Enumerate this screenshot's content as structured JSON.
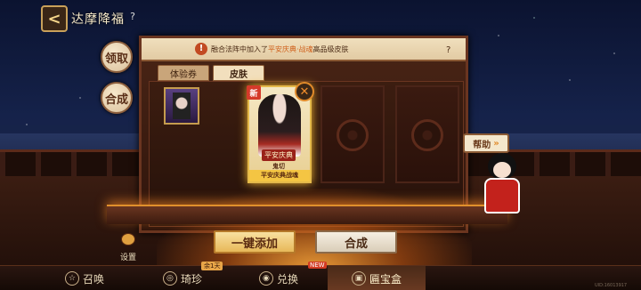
{
  "header": {
    "back_glyph": "<",
    "title": "达摩降福",
    "help": "?"
  },
  "side_buttons": {
    "claim": "领取",
    "combine": "合成"
  },
  "notice": {
    "icon": "!",
    "prefix": "融合法阵中加入了",
    "highlight": "平安庆典·战魂",
    "suffix": "高品级皮肤",
    "help": "?"
  },
  "tabs": [
    {
      "label": "体验券",
      "active": false
    },
    {
      "label": "皮肤",
      "active": true
    }
  ],
  "feature_card": {
    "new_badge": "新",
    "close": "✕",
    "theme": "平安庆典",
    "name": "鬼切",
    "skin": "平安庆典战魂"
  },
  "locked_slots": 2,
  "actions": {
    "add_all": "一键添加",
    "combine": "合成"
  },
  "settings": {
    "label": "设置"
  },
  "help_widget": {
    "label": "帮助",
    "arrow": "»"
  },
  "bottom_nav": [
    {
      "label": "召唤",
      "icon": "summon-icon",
      "glyph": "☆",
      "active": false
    },
    {
      "label": "琦珍",
      "icon": "treasure-icon",
      "glyph": "◎",
      "active": false
    },
    {
      "label": "兑换",
      "icon": "exchange-icon",
      "glyph": "◉",
      "active": false
    },
    {
      "label": "匾宝盒",
      "icon": "box-icon",
      "glyph": "▣",
      "active": true
    }
  ],
  "nav_tags": {
    "treasure_tag": "余1天",
    "exchange_new": "NEW"
  },
  "version": "UID:16013917",
  "colors": {
    "accent_gold": "#e4b94a",
    "board_brown": "#4a2516",
    "alert_red": "#d53a2a"
  }
}
